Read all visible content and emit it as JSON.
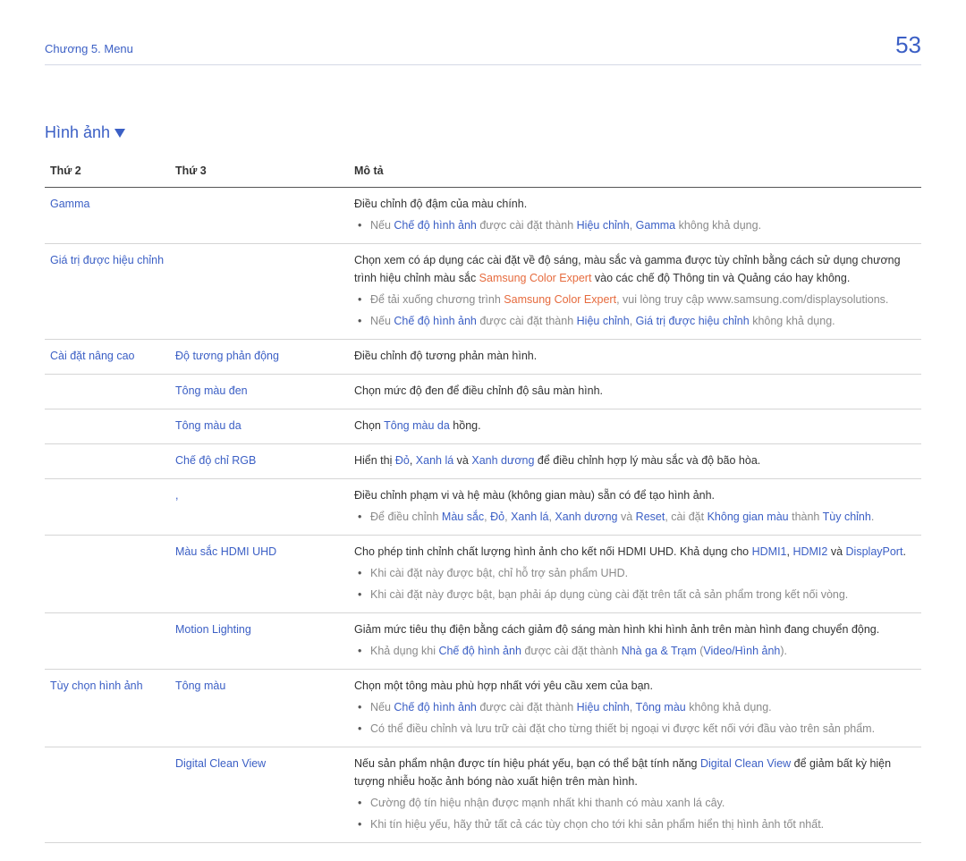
{
  "header": {
    "chapter": "Chương 5. Menu",
    "page": "53"
  },
  "section_title": "Hình ảnh",
  "columns": {
    "c2": "Thứ 2",
    "c3": "Thứ 3",
    "desc": "Mô tả"
  },
  "rows": {
    "gamma": {
      "c2": "Gamma",
      "line1": "Điều chỉnh độ đậm của màu chính.",
      "b1_pre": "Nếu ",
      "b1_k1": "Chế độ hình ảnh",
      "b1_mid": " được cài đặt thành ",
      "b1_k2": "Hiệu chỉnh",
      "b1_sep": ", ",
      "b1_k3": "Gamma",
      "b1_post": " không khả dụng."
    },
    "calib": {
      "c2": "Giá trị được hiệu chỉnh",
      "l1_pre": "Chọn xem có áp dụng các cài đặt về độ sáng, màu sắc và gamma được tùy chỉnh bằng cách sử dụng chương trình hiệu chỉnh màu sắc ",
      "l1_red": "Samsung Color Expert",
      "l1_post": " vào các chế độ Thông tin và Quảng cáo hay không.",
      "b1_pre": "Để tải xuống chương trình ",
      "b1_red": "Samsung Color Expert",
      "b1_post": ", vui lòng truy cập www.samsung.com/displaysolutions.",
      "b2_pre": "Nếu ",
      "b2_k1": "Chế độ hình ảnh",
      "b2_mid": " được cài đặt thành ",
      "b2_k2": "Hiệu chỉnh",
      "b2_sep": ", ",
      "b2_k3": "Giá trị được hiệu chỉnh",
      "b2_post": " không khả dụng."
    },
    "adv_title": "Cài đặt nâng cao",
    "adv_contrast": {
      "c3": "Độ tương phản động",
      "d": "Điều chỉnh độ tương phản màn hình."
    },
    "adv_black": {
      "c3": "Tông màu đen",
      "d": "Chọn mức độ đen để điều chỉnh độ sâu màn hình."
    },
    "adv_flesh": {
      "c3": "Tông màu da",
      "pre": "Chọn ",
      "k": "Tông màu da",
      "post": " hồng."
    },
    "adv_rgb": {
      "c3": "Chế độ chỉ RGB",
      "pre": "Hiển thị ",
      "r": "Đỏ",
      "c1": ", ",
      "g": "Xanh lá",
      "mid": " và ",
      "b": "Xanh dương",
      "post": " để điều chỉnh hợp lý màu sắc và độ bão hòa."
    },
    "adv_space": {
      "c3": ", ",
      "d": "Điều chỉnh phạm vi và hệ màu (không gian màu) sẵn có để tạo hình ảnh.",
      "b_pre": "Để điều chỉnh ",
      "k1": "Màu sắc",
      "c1": ", ",
      "k2": "Đỏ",
      "c2": ", ",
      "k3": "Xanh lá",
      "k4": "Xanh dương",
      "mid1": " và ",
      "k5": "Reset",
      "mid2": ", cài đặt ",
      "k6": "Không gian màu",
      "mid3": " thành ",
      "k7": "Tùy chỉnh",
      "end": "."
    },
    "adv_uhd": {
      "c3": "Màu sắc HDMI UHD",
      "l_pre": "Cho phép tinh chỉnh chất lượng hình ảnh cho kết nối HDMI UHD. Khả dụng cho ",
      "k1": "HDMI1",
      "c1": ", ",
      "k2": "HDMI2",
      "mid": " và ",
      "k3": "DisplayPort",
      "end": ".",
      "b1": "Khi cài đặt này được bật, chỉ hỗ trợ sản phẩm UHD.",
      "b2": "Khi cài đặt này được bật, bạn phải áp dụng cùng cài đặt trên tất cả sản phẩm trong kết nối vòng."
    },
    "adv_motion": {
      "c3": "Motion Lighting",
      "d": "Giảm mức tiêu thụ điện bằng cách giảm độ sáng màn hình khi hình ảnh trên màn hình đang chuyển động.",
      "b_pre": "Khả dụng khi ",
      "k1": "Chế độ hình ảnh",
      "mid": " được cài đặt thành ",
      "k2": "Nhà ga & Trạm",
      "p1": " (",
      "k3": "Video/Hình ảnh",
      "p2": ")."
    },
    "opt_title": "Tùy chọn hình ảnh",
    "opt_tone": {
      "c3": "Tông màu",
      "d": "Chọn một tông màu phù hợp nhất với yêu cầu xem của bạn.",
      "b1_pre": "Nếu ",
      "b1_k1": "Chế độ hình ảnh",
      "b1_mid": " được cài đặt thành ",
      "b1_k2": "Hiệu chỉnh",
      "b1_sep": ", ",
      "b1_k3": "Tông màu",
      "b1_post": " không khả dụng.",
      "b2": "Có thể điều chỉnh và lưu trữ cài đặt cho từng thiết bị ngoại vi được kết nối với đầu vào trên sản phẩm."
    },
    "opt_dcv": {
      "c3": "Digital Clean View",
      "l_pre": "Nếu sản phẩm nhận được tín hiệu phát yếu, bạn có thể bật tính năng ",
      "k": "Digital Clean View",
      "l_post": " để giảm bất kỳ hiện tượng nhiễu hoặc ảnh bóng nào xuất hiện trên màn hình.",
      "b1": "Cường độ tín hiệu nhận được mạnh nhất khi thanh có màu xanh lá cây.",
      "b2": "Khi tín hiệu yếu, hãy thử tất cả các tùy chọn cho tới khi sản phẩm hiển thị hình ảnh tốt nhất."
    }
  }
}
